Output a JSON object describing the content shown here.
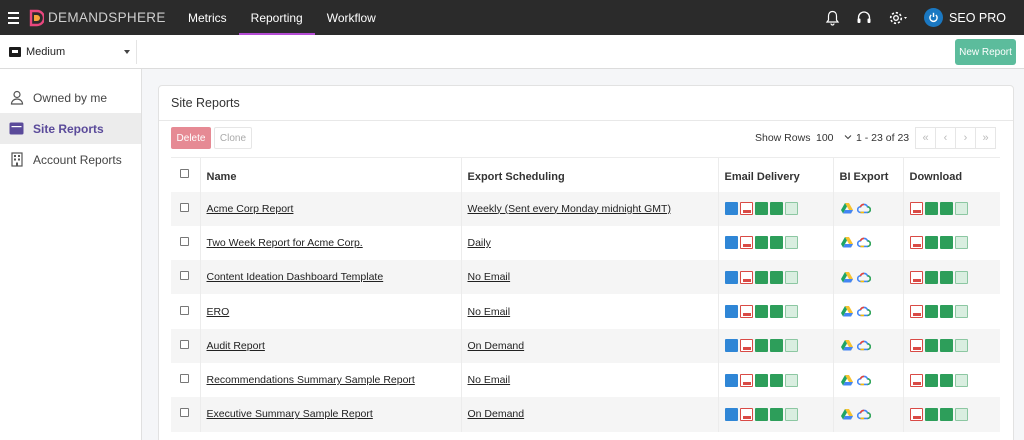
{
  "brand": {
    "name": "DEMANDSPHERE"
  },
  "nav": {
    "tabs": [
      {
        "label": "Metrics"
      },
      {
        "label": "Reporting"
      },
      {
        "label": "Workflow"
      }
    ],
    "active": "Reporting",
    "accent": "#b44bd4"
  },
  "user": {
    "label": "SEO PRO"
  },
  "subbar": {
    "select_value": "Medium",
    "new_report": "New Report"
  },
  "sidebar": {
    "items": [
      {
        "label": "Owned by me",
        "icon": "user-icon"
      },
      {
        "label": "Site Reports",
        "icon": "report-icon",
        "active": true
      },
      {
        "label": "Account Reports",
        "icon": "building-icon"
      }
    ]
  },
  "card": {
    "title": "Site Reports",
    "delete_label": "Delete",
    "clone_label": "Clone",
    "show_rows_label": "Show Rows",
    "rows_value": "100",
    "range_text": "1 - 23 of 23",
    "columns": [
      "Name",
      "Export Scheduling",
      "Email Delivery",
      "BI Export",
      "Download"
    ]
  },
  "rows": [
    {
      "name": "Acme Corp Report",
      "schedule": "Weekly (Sent every Monday midnight GMT)"
    },
    {
      "name": "Two Week Report for Acme Corp.",
      "schedule": "Daily"
    },
    {
      "name": "Content Ideation Dashboard Template",
      "schedule": "No Email"
    },
    {
      "name": "ERO",
      "schedule": "No Email"
    },
    {
      "name": "Audit Report",
      "schedule": "On Demand"
    },
    {
      "name": "Recommendations Summary Sample Report",
      "schedule": "No Email"
    },
    {
      "name": "Executive Summary Sample Report",
      "schedule": "On Demand"
    }
  ],
  "colors": {
    "delete": "#e68a94",
    "new_report": "#5cbc9c",
    "topbar": "#2b2b2b",
    "active_text": "#5a4a9a"
  }
}
